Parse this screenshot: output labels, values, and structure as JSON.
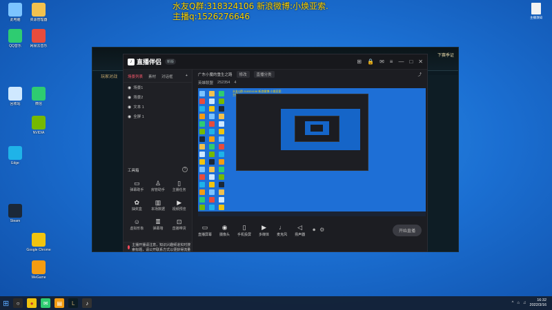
{
  "overlay_text": {
    "line1": "水友Q群:318324106 新浪微博:小焕亚索.",
    "line2": "主播q:1526276646"
  },
  "desktop_icons": [
    {
      "label": "此电脑",
      "icon": "computer-icon",
      "color": "#7cc4ff"
    },
    {
      "label": "资源管理器",
      "icon": "folder-icon",
      "color": "#f2c14e"
    },
    {
      "label": "QQ音乐",
      "icon": "music-icon",
      "color": "#2ecc71"
    },
    {
      "label": "网易云音乐",
      "icon": "music-icon",
      "color": "#e74c3c"
    },
    {
      "label": "回收站",
      "icon": "recycle-icon",
      "color": "#cfe8ff"
    },
    {
      "label": "微信",
      "icon": "wechat-icon",
      "color": "#2ecc71"
    },
    {
      "label": "NVIDIA",
      "icon": "nvidia-icon",
      "color": "#76b900"
    },
    {
      "label": "Edge",
      "icon": "edge-icon",
      "color": "#1fb3e8"
    },
    {
      "label": "Google Chrome",
      "icon": "chrome-icon",
      "color": "#f1c40f"
    },
    {
      "label": "Steam",
      "icon": "steam-icon",
      "color": "#1b2838"
    },
    {
      "label": "WeGame",
      "icon": "wegame-icon",
      "color": "#f39c12"
    }
  ],
  "game_window": {
    "tab_label": "玩家对战",
    "chip_label": "下赛季证"
  },
  "app": {
    "logo_text": "直播伴侣",
    "version_badge": "新版",
    "panel_tabs": [
      "场景列表",
      "素材",
      "对话框"
    ],
    "scenes": [
      {
        "name": "场景1"
      },
      {
        "name": "场景2"
      },
      {
        "name": "文本 1"
      },
      {
        "name": "全屏 1"
      }
    ],
    "toolbox_title": "工具箱",
    "tools": [
      {
        "label": "弹幕助手",
        "icon": "chat-icon"
      },
      {
        "label": "房管助手",
        "icon": "user-icon"
      },
      {
        "label": "主播任务",
        "icon": "clipboard-icon"
      },
      {
        "label": "抽奖盒",
        "icon": "gift-icon"
      },
      {
        "label": "本场数据",
        "icon": "chart-icon"
      },
      {
        "label": "视频预览",
        "icon": "play-icon"
      },
      {
        "label": "虚拟形象",
        "icon": "avatar-icon"
      },
      {
        "label": "弹幕墙",
        "icon": "wall-icon"
      },
      {
        "label": "直播带货",
        "icon": "cart-icon"
      }
    ],
    "notice_text": "主播开播请注意，知识兴趣频道实时搜索标题，请公开联系方式以便获得流量",
    "room_title": "广东小魔的重生之路",
    "edit_label": "修改",
    "category_label": "英雄联盟",
    "stream_type": "直播分类",
    "viewers": "252354",
    "likes": "4",
    "bottom_tools": [
      {
        "label": "直播屏幕",
        "icon": "monitor-icon"
      },
      {
        "label": "摄像头",
        "icon": "camera-icon"
      },
      {
        "label": "手机投屏",
        "icon": "phone-icon"
      },
      {
        "label": "多媒体",
        "icon": "media-icon"
      },
      {
        "label": "麦克风",
        "icon": "mic-icon"
      },
      {
        "label": "扬声器",
        "icon": "speaker-icon"
      }
    ],
    "start_button": "开始直播"
  },
  "taskbar": {
    "time": "16:32",
    "date": "2022/3/16"
  },
  "right_file": {
    "label": "主播须知"
  }
}
